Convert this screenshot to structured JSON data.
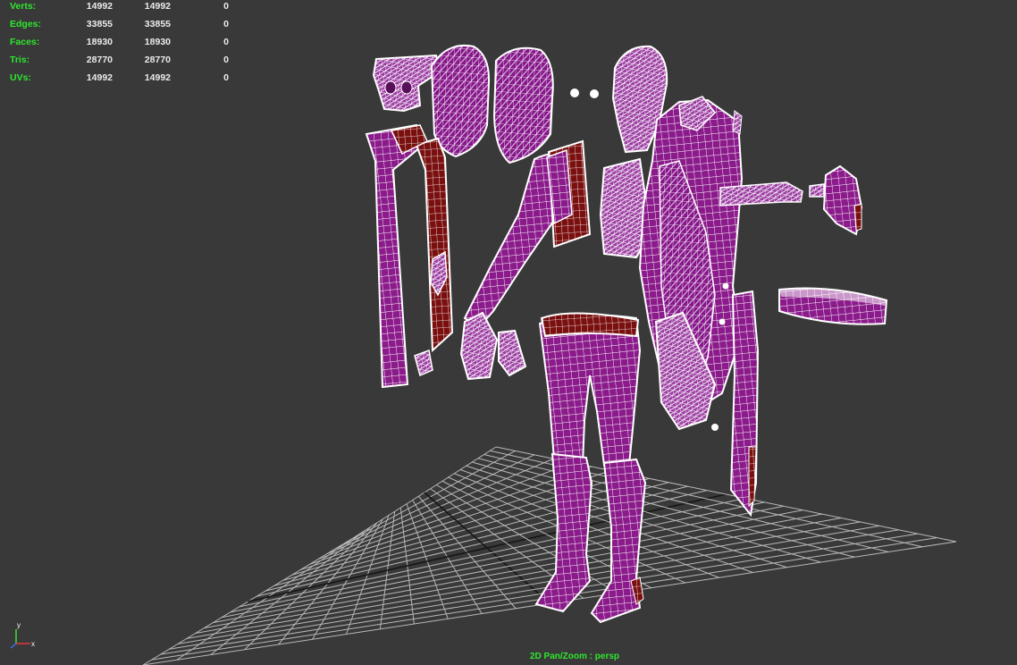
{
  "hud": {
    "rows": [
      {
        "label": "Verts:",
        "v1": "14992",
        "v2": "14992",
        "v3": "0"
      },
      {
        "label": "Edges:",
        "v1": "33855",
        "v2": "33855",
        "v3": "0"
      },
      {
        "label": "Faces:",
        "v1": "18930",
        "v2": "18930",
        "v3": "0"
      },
      {
        "label": "Tris:",
        "v1": "28770",
        "v2": "28770",
        "v3": "0"
      },
      {
        "label": "UVs:",
        "v1": "14992",
        "v2": "14992",
        "v3": "0"
      }
    ]
  },
  "viewport": {
    "camera_label": "2D Pan/Zoom : persp",
    "axis_y": "y",
    "axis_x": "x",
    "background": "#393939",
    "mesh_fill": "#8b1a8b",
    "mesh_backface": "#7a0f0f",
    "wire_color": "#ffffff",
    "grid_color": "#d8d8d8"
  }
}
